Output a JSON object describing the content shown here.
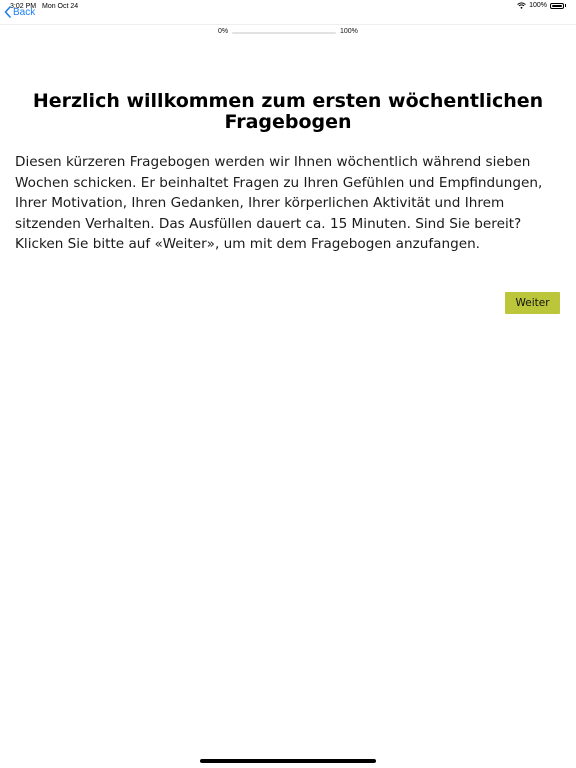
{
  "status_bar": {
    "time": "3:02 PM",
    "date": "Mon Oct 24",
    "battery_percent": "100%",
    "battery_level": 1.0
  },
  "nav": {
    "back_label": "Back",
    "back_icon": "chevron-left-icon"
  },
  "progress": {
    "start_label": "0%",
    "end_label": "100%",
    "value": 0
  },
  "content": {
    "title": "Herzlich willkommen zum ersten wöchentlichen Fragebogen",
    "body": "Diesen kürzeren Fragebogen werden wir Ihnen wöchentlich während sieben Wochen schicken. Er beinhaltet Fragen zu Ihren Gefühlen und Empfindungen, Ihrer Motivation, Ihren Gedanken, Ihrer körperlichen Aktivität und Ihrem sitzenden Verhalten. Das Ausfüllen dauert ca. 15 Minuten. Sind Sie bereit? Klicken Sie bitte auf «Weiter», um mit dem Fragebogen anzufangen."
  },
  "actions": {
    "next_label": "Weiter"
  },
  "colors": {
    "accent": "#bcc63a",
    "link": "#1a7ff5",
    "text": "#1a1a1a"
  }
}
